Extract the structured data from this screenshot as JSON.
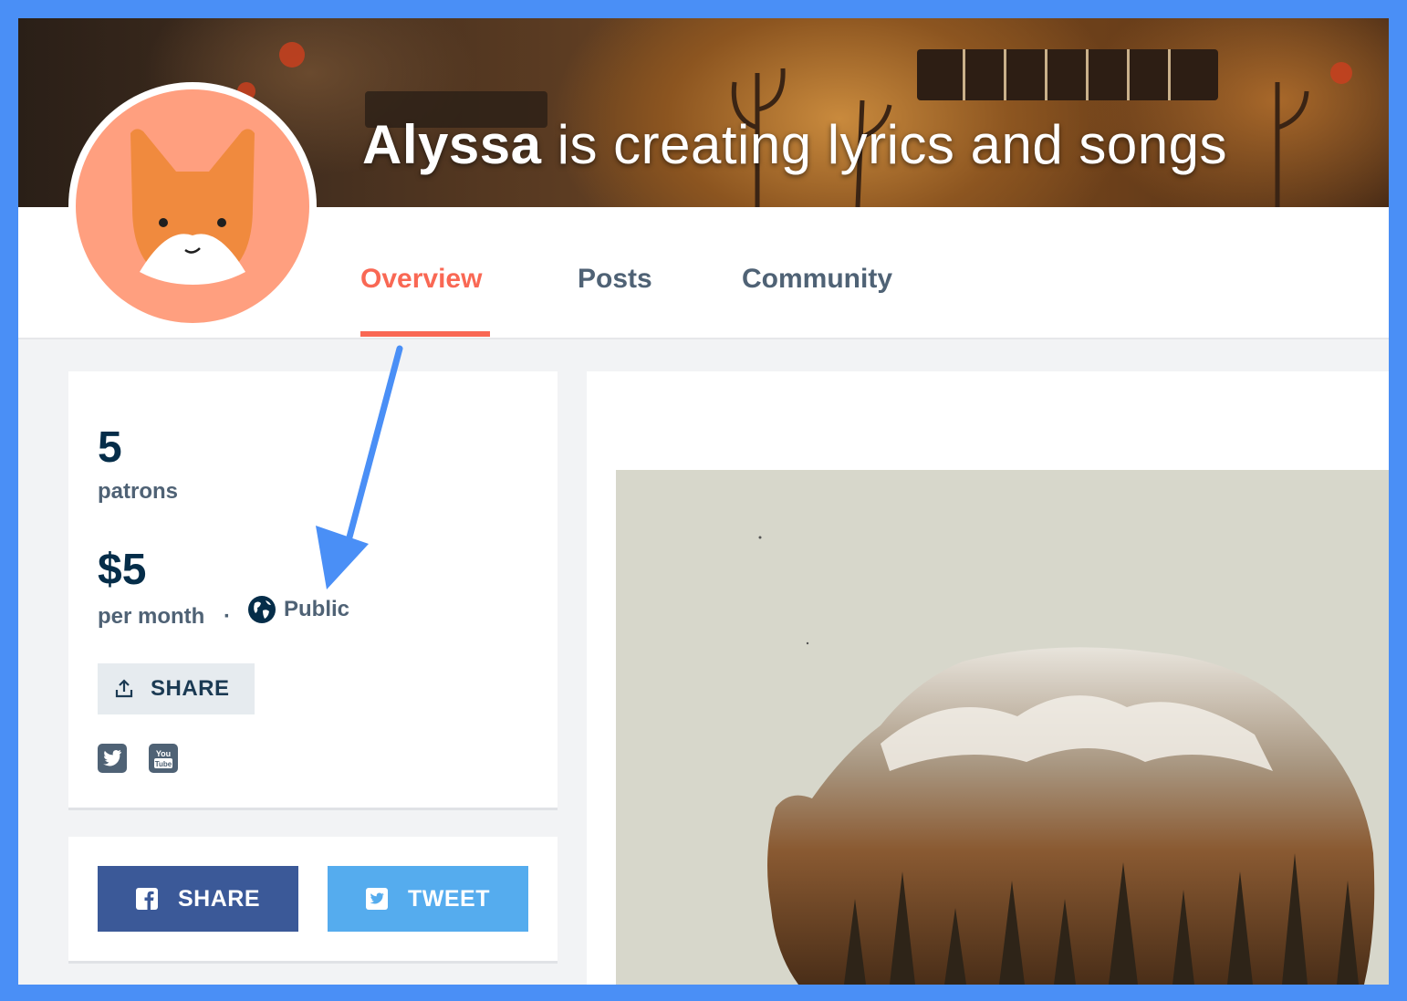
{
  "banner": {
    "creator_name": "Alyssa",
    "title_rest": " is creating lyrics and songs"
  },
  "nav": {
    "tabs": [
      {
        "label": "Overview",
        "active": true
      },
      {
        "label": "Posts",
        "active": false
      },
      {
        "label": "Community",
        "active": false
      }
    ]
  },
  "stats": {
    "patrons_count": "5",
    "patrons_label": "patrons",
    "amount": "$5",
    "amount_label": "per month",
    "separator": "·",
    "visibility": "Public"
  },
  "share_card": {
    "share_label": "SHARE",
    "social_icons": [
      "twitter-icon",
      "youtube-icon"
    ]
  },
  "share_buttons": {
    "facebook_label": "SHARE",
    "twitter_label": "TWEET"
  },
  "colors": {
    "accent": "#f96854",
    "facebook": "#3b5998",
    "twitter": "#55acee",
    "text_dark": "#052d49",
    "text_muted": "#4f6275",
    "annotation_arrow": "#4a8ff6"
  }
}
